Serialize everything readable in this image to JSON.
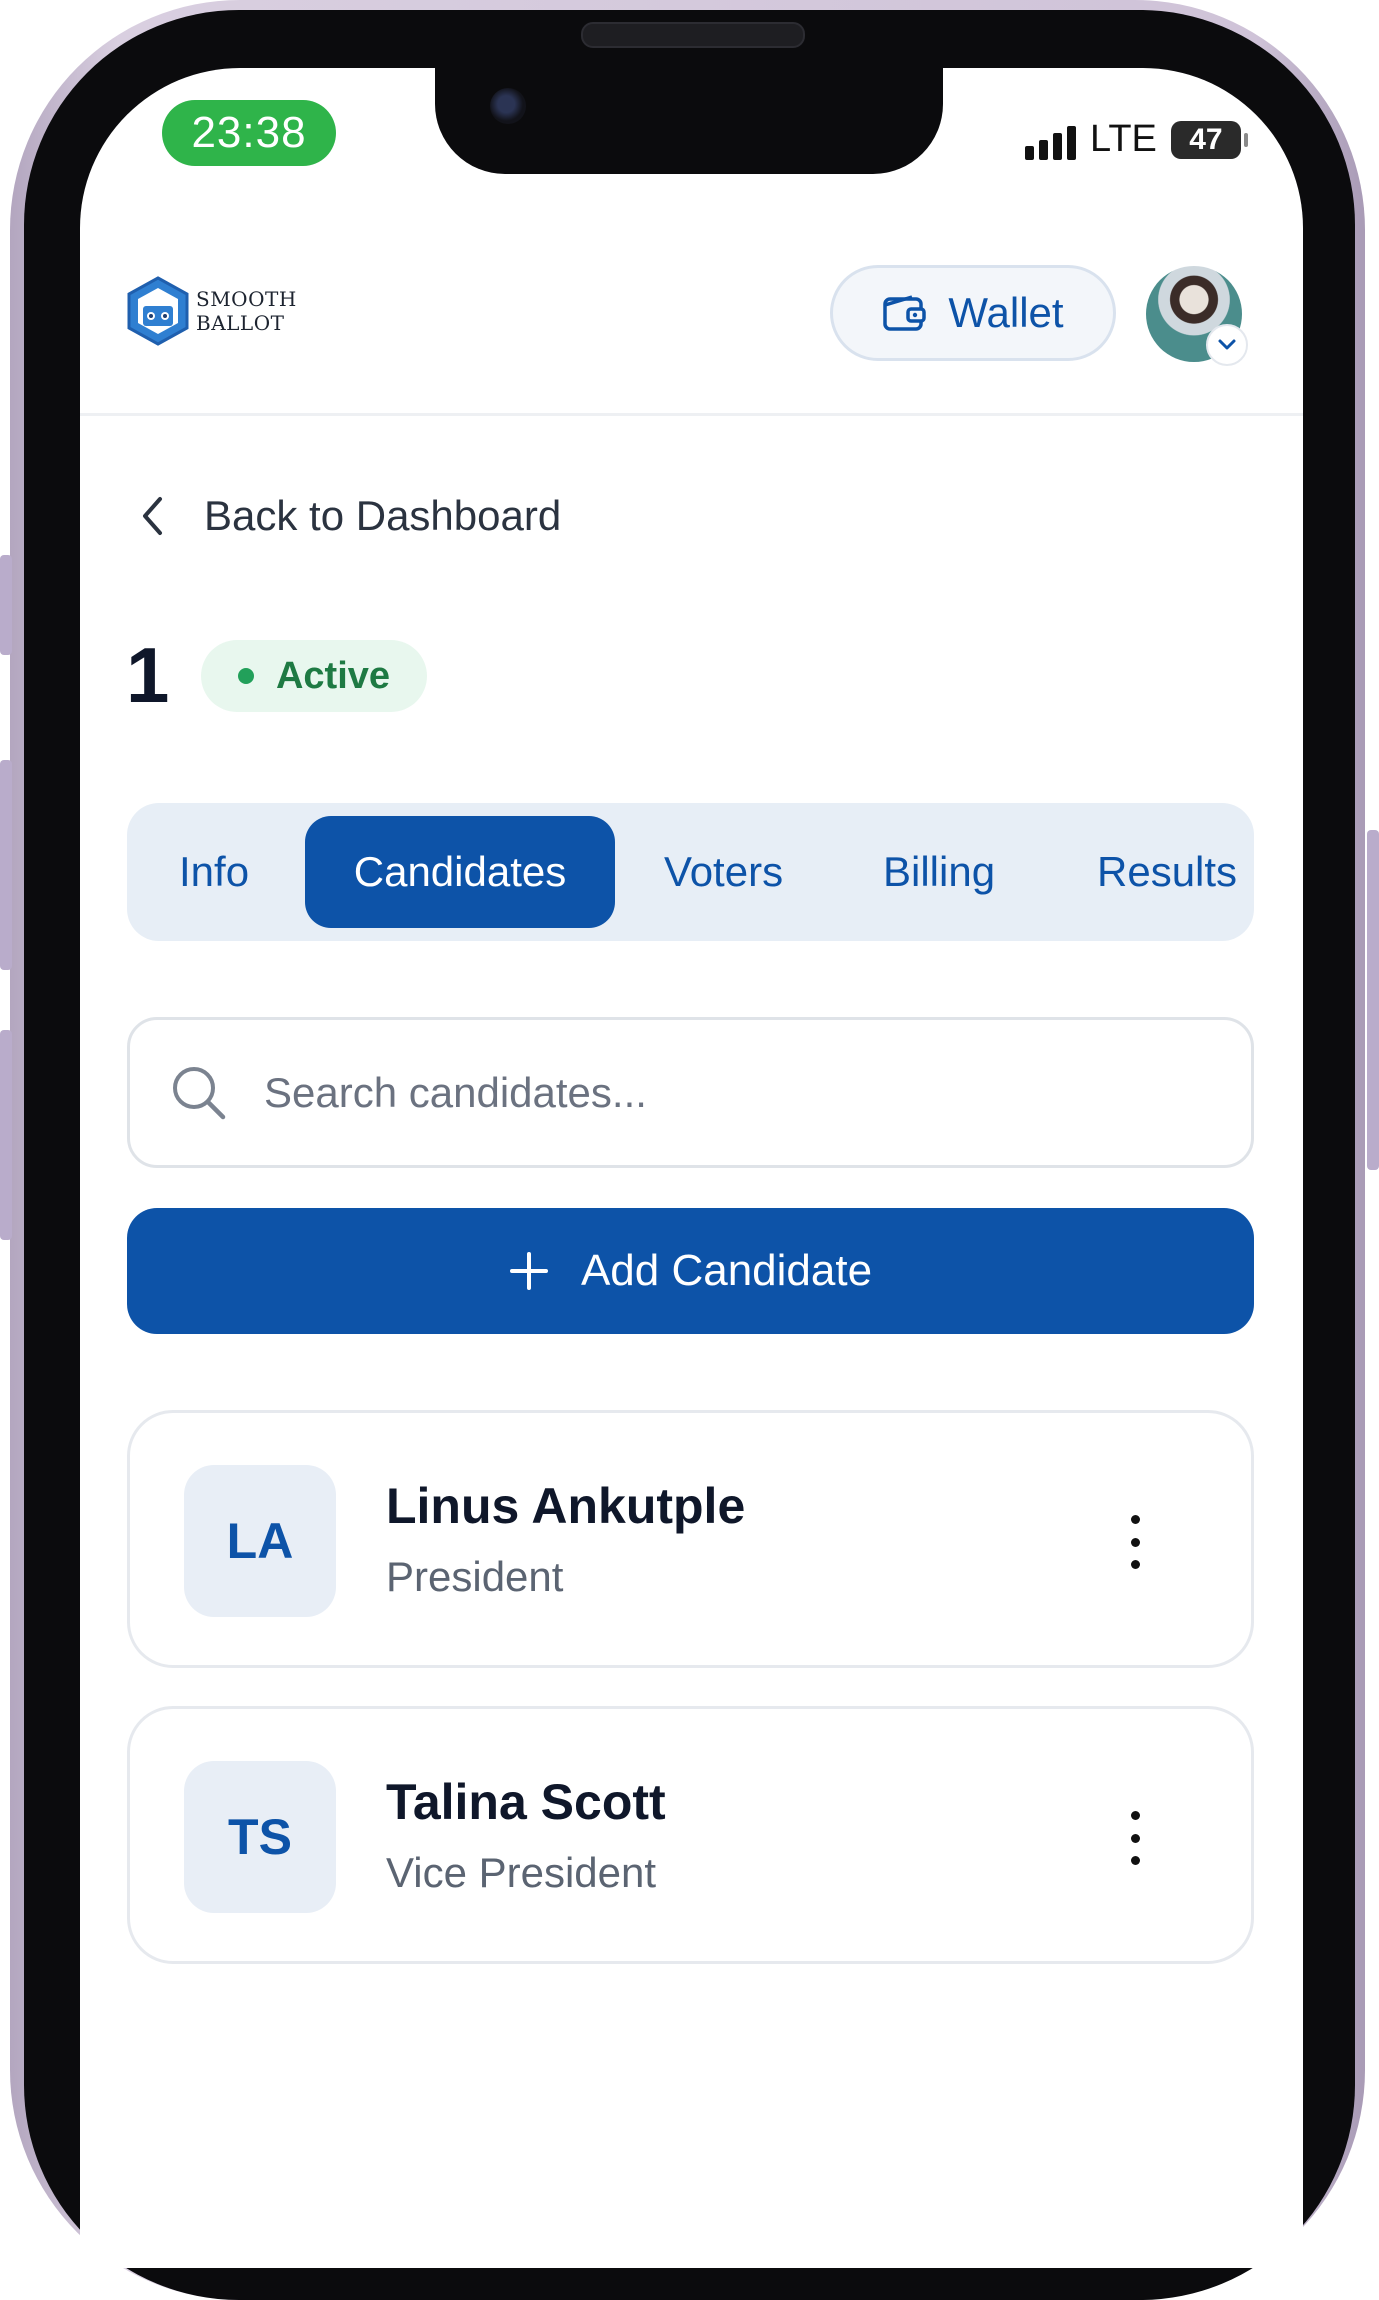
{
  "status_bar": {
    "time": "23:38",
    "network": "LTE",
    "battery": "47"
  },
  "header": {
    "logo_line1": "SMOOTH",
    "logo_line2": "BALLOT",
    "wallet_label": "Wallet"
  },
  "nav": {
    "back_label": "Back to Dashboard"
  },
  "election": {
    "title": "1",
    "status": "Active"
  },
  "tabs": [
    {
      "label": "Info",
      "active": false
    },
    {
      "label": "Candidates",
      "active": true
    },
    {
      "label": "Voters",
      "active": false
    },
    {
      "label": "Billing",
      "active": false
    },
    {
      "label": "Results",
      "active": false
    }
  ],
  "search": {
    "placeholder": "Search candidates...",
    "value": ""
  },
  "add_button": {
    "label": "Add Candidate"
  },
  "candidates": [
    {
      "initials": "LA",
      "name": "Linus Ankutple",
      "role": "President"
    },
    {
      "initials": "TS",
      "name": "Talina Scott",
      "role": "Vice President"
    }
  ],
  "colors": {
    "primary": "#0d53a8",
    "active_badge_bg": "#e8f7ee",
    "active_badge_text": "#1e7a43",
    "time_pill": "#2fb44a",
    "tab_bar_bg": "#e7eef6"
  },
  "icons": {
    "wallet": "wallet-icon",
    "back": "chevron-left-icon",
    "search": "search-icon",
    "add": "plus-icon",
    "more": "more-vertical-icon",
    "avatar_menu": "chevron-down-icon"
  }
}
